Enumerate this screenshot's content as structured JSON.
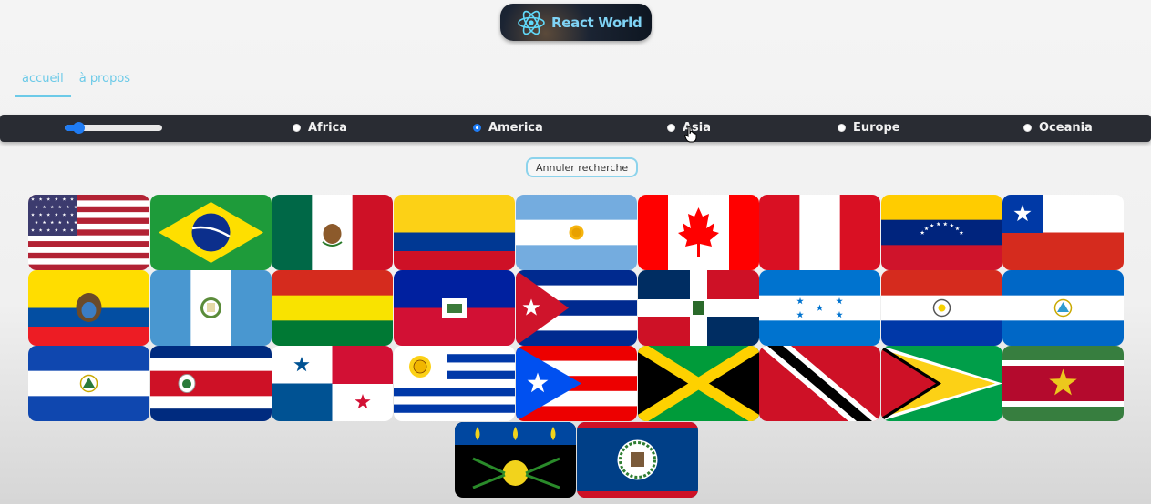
{
  "header": {
    "logo_text": "React World"
  },
  "nav": {
    "items": [
      {
        "label": "accueil",
        "active": true
      },
      {
        "label": "à propos",
        "active": false
      }
    ]
  },
  "filters": {
    "slider_value_fraction": 0.14,
    "regions": [
      {
        "label": "Africa",
        "checked": false
      },
      {
        "label": "America",
        "checked": true
      },
      {
        "label": "Asia",
        "checked": false
      },
      {
        "label": "Europe",
        "checked": false
      },
      {
        "label": "Oceania",
        "checked": false
      }
    ]
  },
  "cancel_button": {
    "label": "Annuler recherche"
  },
  "flags": [
    "usa",
    "brazil",
    "mexico",
    "colombia",
    "argentina",
    "canada",
    "peru",
    "venezuela",
    "chile",
    "ecuador",
    "guatemala",
    "bolivia",
    "haiti",
    "cuba",
    "dominican-republic",
    "honduras",
    "paraguay",
    "nicaragua",
    "el-salvador",
    "costa-rica",
    "panama",
    "uruguay",
    "puerto-rico",
    "jamaica",
    "trinidad-and-tobago",
    "guyana",
    "suriname",
    "guadeloupe",
    "belize"
  ],
  "colors": {
    "accent": "#6ccae8",
    "bar": "#292c33",
    "radio_active": "#1f7cf4"
  }
}
